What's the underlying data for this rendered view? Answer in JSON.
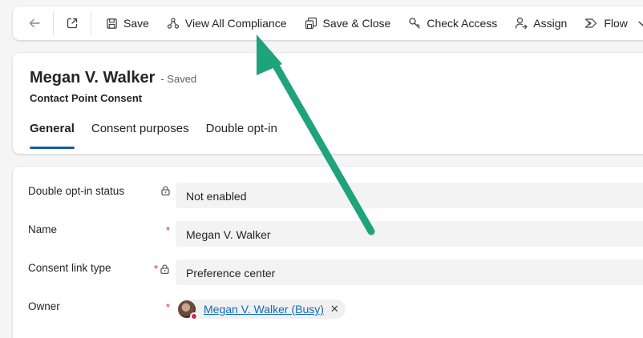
{
  "toolbar": {
    "back_icon": "back-arrow-icon",
    "popout_icon": "open-in-new-window-icon",
    "save_label": "Save",
    "view_all_compliance_label": "View All Compliance",
    "save_close_label": "Save & Close",
    "check_access_label": "Check Access",
    "assign_label": "Assign",
    "flow_label": "Flow"
  },
  "record": {
    "title": "Megan V. Walker",
    "saved_status": "- Saved",
    "entity": "Contact Point Consent"
  },
  "tabs": [
    {
      "label": "General",
      "active": true
    },
    {
      "label": "Consent purposes",
      "active": false
    },
    {
      "label": "Double opt-in",
      "active": false
    }
  ],
  "fields": [
    {
      "label": "Double opt-in status",
      "required": false,
      "locked": true,
      "value": "Not enabled"
    },
    {
      "label": "Name",
      "required": true,
      "locked": false,
      "value": "Megan V. Walker"
    },
    {
      "label": "Consent link type",
      "required": true,
      "locked": true,
      "value": "Preference center"
    },
    {
      "label": "Owner",
      "required": true,
      "locked": false,
      "value": "Megan V. Walker (Busy)"
    }
  ],
  "required_marker": "*",
  "colors": {
    "accent": "#115ea3",
    "link": "#0f6cbd",
    "required": "#c4314b",
    "annotation_arrow": "#1fa37a",
    "presence_busy": "#c4314b"
  }
}
